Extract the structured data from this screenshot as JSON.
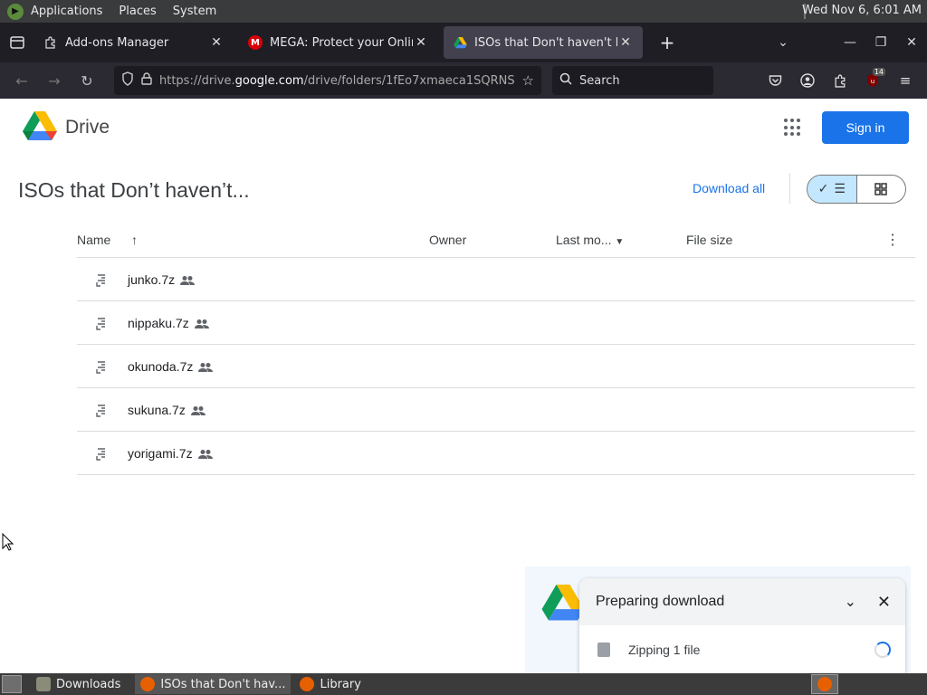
{
  "desktop_panel": {
    "menus": [
      "Applications",
      "Places",
      "System"
    ],
    "clock": "Wed Nov  6,  6:01 AM"
  },
  "browser": {
    "tabs": [
      {
        "title": "Add-ons Manager",
        "icon": "puzzle-icon"
      },
      {
        "title": "MEGA: Protect your Online Privacy",
        "icon": "mega-icon"
      },
      {
        "title": "ISOs that Don't haven't been",
        "icon": "google-drive-icon"
      }
    ],
    "new_tab": "+",
    "url_prefix": "https://drive.",
    "url_domain": "google.com",
    "url_rest": "/drive/folders/1fEo7xmaeca1SQRNS",
    "search_placeholder": "Search",
    "ublock_badge": "14"
  },
  "drive": {
    "product_name": "Drive",
    "sign_in": "Sign in",
    "folder_title": "ISOs that Don’t haven’t...",
    "download_all": "Download all",
    "columns": {
      "name": "Name",
      "owner": "Owner",
      "last_modified": "Last mo...",
      "file_size": "File size"
    },
    "files": [
      {
        "name": "junko.7z"
      },
      {
        "name": "nippaku.7z"
      },
      {
        "name": "okunoda.7z"
      },
      {
        "name": "sukuna.7z"
      },
      {
        "name": "yorigami.7z"
      }
    ]
  },
  "download_toast": {
    "title": "Preparing download",
    "status": "Zipping 1 file"
  },
  "taskbar": {
    "items": [
      "Downloads",
      "ISOs that Don't hav...",
      "Library"
    ]
  },
  "colors": {
    "accent": "#1a73e8",
    "tab_bar": "#1f1e25",
    "nav_bar": "#2b2a33"
  }
}
